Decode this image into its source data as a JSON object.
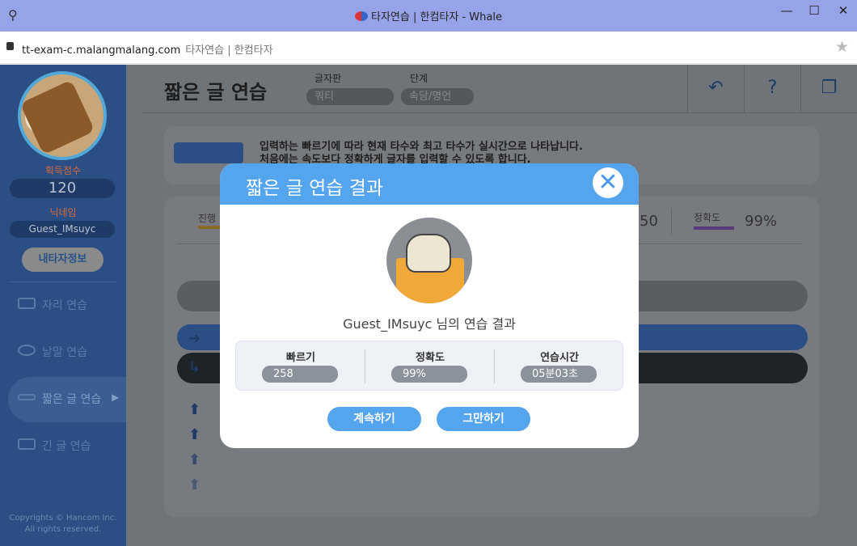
{
  "browser": {
    "window_title": "타자연습 | 한컴타자 - Whale",
    "url": "tt-exam-c.malangmalang.com",
    "page_title": "타자연습 | 한컴타자"
  },
  "sidebar": {
    "score_label": "획득점수",
    "score_value": "120",
    "nickname_label": "닉네임",
    "nickname_value": "Guest_IMsuyc",
    "my_info_button": "내타자정보",
    "items": [
      {
        "label": "자리 연습"
      },
      {
        "label": "낱말 연습"
      },
      {
        "label": "짧은 글 연습"
      },
      {
        "label": "긴 글 연습"
      }
    ],
    "copyright_line1": "Copyrights © Hancom Inc.",
    "copyright_line2": "All rights reserved."
  },
  "header": {
    "title": "짧은 글 연습",
    "keyboard_label": "글자판",
    "keyboard_value": "쿼티",
    "level_label": "단계",
    "level_value": "속담/명언"
  },
  "info": {
    "line1": "입력하는 빠르기에 따라 현재 타수와 최고 타수가 실시간으로 나타납니다.",
    "line2": "처음에는 속도보다 정확하게 글자를 입력할 수 있도록 합니다."
  },
  "progress": {
    "progress_label": "진행",
    "speed_partial": "50",
    "accuracy_label": "정확도",
    "accuracy_value": "99%"
  },
  "modal": {
    "title": "짧은 글 연습 결과",
    "result_name": "Guest_IMsuyc 님의 연습 결과",
    "stats": [
      {
        "label": "빠르기",
        "value": "258"
      },
      {
        "label": "정확도",
        "value": "99%"
      },
      {
        "label": "연습시간",
        "value": "05분03초"
      }
    ],
    "continue_button": "계속하기",
    "stop_button": "그만하기",
    "accent": "#55a4ee"
  }
}
